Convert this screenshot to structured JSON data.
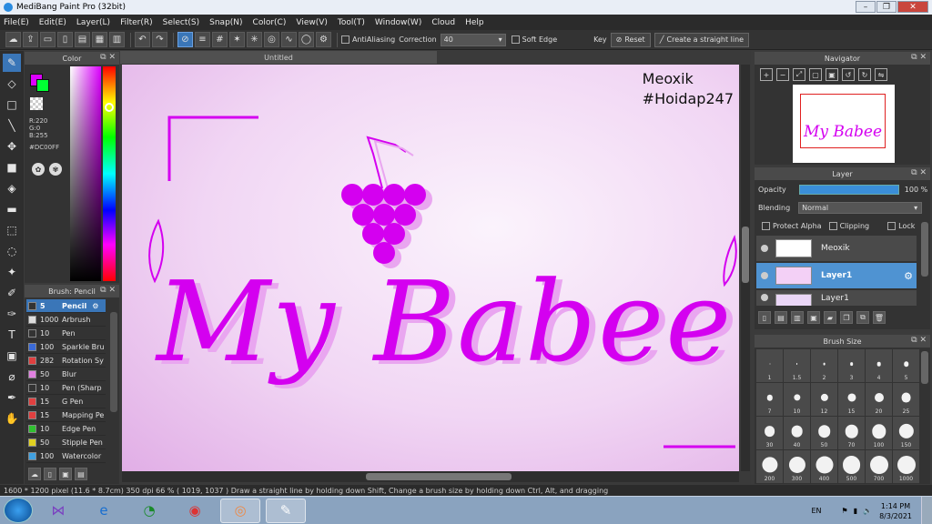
{
  "window": {
    "title": "MediBang Paint Pro (32bit)",
    "controls": [
      "–",
      "❐",
      "✕"
    ]
  },
  "menu": [
    "File(E)",
    "Edit(E)",
    "Layer(L)",
    "Filter(R)",
    "Select(S)",
    "Snap(N)",
    "Color(C)",
    "View(V)",
    "Tool(T)",
    "Window(W)",
    "Cloud",
    "Help"
  ],
  "toolbar": {
    "antialiasing_label": "AntiAliasing",
    "correction_label": "Correction",
    "correction_value": "40",
    "soft_edge_label": "Soft Edge",
    "key_label": "Key",
    "reset_label": "Reset",
    "straight_line_label": "Create a straight line"
  },
  "color_panel": {
    "title": "Color",
    "rgb": "R:220\nG:0\nB:255",
    "hex": "#DC00FF",
    "foreground": "#dc00ff",
    "background": "#00ff33"
  },
  "brush_panel": {
    "title": "Brush: Pencil",
    "items": [
      {
        "size": "5",
        "name": "Pencil",
        "color": "#333333",
        "selected": true
      },
      {
        "size": "1000",
        "name": "Arbrush",
        "color": "#dddddd"
      },
      {
        "size": "10",
        "name": "Pen",
        "color": "#333333"
      },
      {
        "size": "100",
        "name": "Sparkle Bru",
        "color": "#3a6ad8"
      },
      {
        "size": "282",
        "name": "Rotation Sy",
        "color": "#e04040"
      },
      {
        "size": "50",
        "name": "Blur",
        "color": "#e080e0"
      },
      {
        "size": "10",
        "name": "Pen (Sharp",
        "color": "#333333"
      },
      {
        "size": "15",
        "name": "G Pen",
        "color": "#e04040"
      },
      {
        "size": "15",
        "name": "Mapping Pe",
        "color": "#e04040"
      },
      {
        "size": "10",
        "name": "Edge Pen",
        "color": "#30c030"
      },
      {
        "size": "50",
        "name": "Stipple Pen",
        "color": "#e0d020"
      },
      {
        "size": "100",
        "name": "Watercolor",
        "color": "#40a0e0"
      }
    ]
  },
  "document": {
    "tab_title": "Untitled",
    "watermark_line1": "Meoxik",
    "watermark_line2": "#Hoidap247",
    "art_text": "My Babee"
  },
  "navigator": {
    "title": "Navigator",
    "thumb_text": "My Babee"
  },
  "layer_panel": {
    "title": "Layer",
    "opacity_label": "Opacity",
    "opacity_value": "100 %",
    "blending_label": "Blending",
    "blending_value": "Normal",
    "protect_alpha_label": "Protect Alpha",
    "clipping_label": "Clipping",
    "lock_label": "Lock",
    "layers": [
      {
        "name": "Meoxik",
        "selected": false
      },
      {
        "name": "Layer1",
        "selected": true
      },
      {
        "name": "Layer1",
        "selected": false
      }
    ]
  },
  "brush_size_panel": {
    "title": "Brush Size",
    "sizes": [
      "1",
      "1.5",
      "2",
      "3",
      "4",
      "5",
      "7",
      "10",
      "12",
      "15",
      "20",
      "25",
      "30",
      "40",
      "50",
      "70",
      "100",
      "150",
      "200",
      "300",
      "400",
      "500",
      "700",
      "1000"
    ]
  },
  "status": {
    "text": "1600 * 1200 pixel  (11.6 * 8.7cm)  350 dpi  66 %  ( 1019, 1037 )  Draw a straight line by holding down Shift, Change a brush size by holding down Ctrl, Alt, and dragging"
  },
  "taskbar": {
    "lang": "EN",
    "time": "1:14 PM",
    "date": "8/3/2021"
  }
}
